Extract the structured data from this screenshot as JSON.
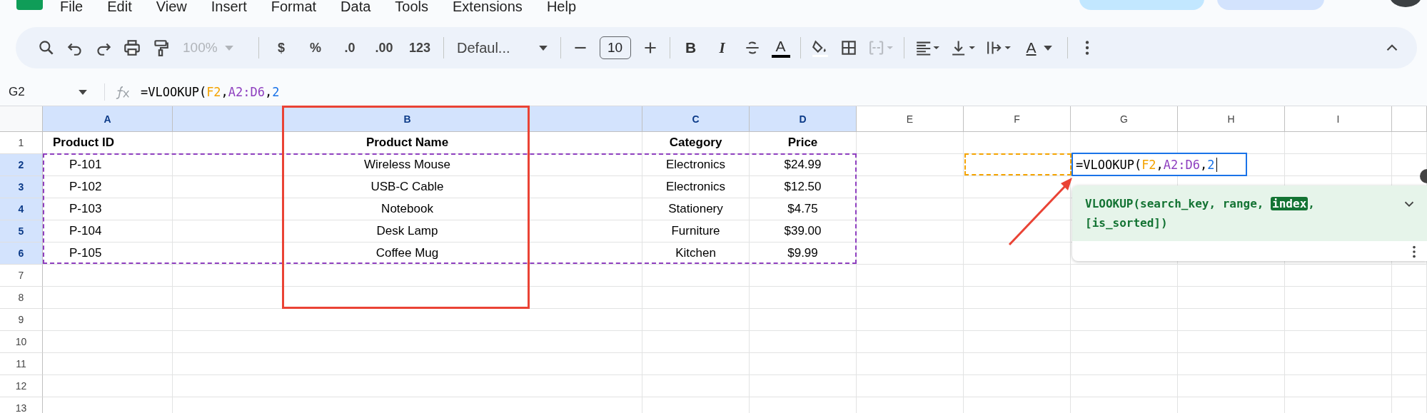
{
  "menu": [
    {
      "label": "File"
    },
    {
      "label": "Edit"
    },
    {
      "label": "View"
    },
    {
      "label": "Insert"
    },
    {
      "label": "Format"
    },
    {
      "label": "Data"
    },
    {
      "label": "Tools"
    },
    {
      "label": "Extensions"
    },
    {
      "label": "Help"
    }
  ],
  "toolbar": {
    "zoom": {
      "value": "100%",
      "disabled": true
    },
    "number_formats": [
      "$",
      "%",
      ".0",
      ".00",
      "123"
    ],
    "font": {
      "value": "Defaul..."
    },
    "font_size": {
      "value": "10"
    },
    "bold": "B",
    "italic": "I",
    "text_color": {
      "glyph": "A",
      "color": "#000000"
    },
    "merge": {
      "disabled": true
    },
    "rotate": "A"
  },
  "formula_bar": {
    "cell": "G2",
    "formula": [
      {
        "text": "=VLOOKUP(",
        "color": "#000000"
      },
      {
        "text": "F2",
        "color": "#f4a300"
      },
      {
        "text": ",",
        "color": "#000000"
      },
      {
        "text": "A2:D6",
        "color": "#8e3fbf"
      },
      {
        "text": ",",
        "color": "#000000"
      },
      {
        "text": "2",
        "color": "#1a73e8"
      }
    ]
  },
  "sheet": {
    "columns": [
      {
        "label": "A",
        "selected": true
      },
      {
        "label": "B",
        "selected": true
      },
      {
        "label": "C",
        "selected": true
      },
      {
        "label": "D",
        "selected": true
      },
      {
        "label": "E",
        "selected": false
      },
      {
        "label": "F",
        "selected": false
      },
      {
        "label": "G",
        "selected": false
      },
      {
        "label": "H",
        "selected": false
      },
      {
        "label": "I",
        "selected": false
      }
    ],
    "rows": [
      {
        "label": "1",
        "selected": false,
        "kind": "header",
        "cells": [
          "Product ID",
          "Product Name",
          "Category",
          "Price"
        ]
      },
      {
        "label": "2",
        "selected": true,
        "kind": "data",
        "cells": [
          "P-101",
          "Wireless Mouse",
          "Electronics",
          "$24.99"
        ]
      },
      {
        "label": "3",
        "selected": true,
        "kind": "data",
        "cells": [
          "P-102",
          "USB-C Cable",
          "Electronics",
          "$12.50"
        ]
      },
      {
        "label": "4",
        "selected": true,
        "kind": "data",
        "cells": [
          "P-103",
          "Notebook",
          "Stationery",
          "$4.75"
        ]
      },
      {
        "label": "5",
        "selected": true,
        "kind": "data",
        "cells": [
          "P-104",
          "Desk Lamp",
          "Furniture",
          "$39.00"
        ]
      },
      {
        "label": "6",
        "selected": true,
        "kind": "data",
        "cells": [
          "P-105",
          "Coffee Mug",
          "Kitchen",
          "$9.99"
        ]
      },
      {
        "label": "7",
        "selected": false
      },
      {
        "label": "8",
        "selected": false
      },
      {
        "label": "9",
        "selected": false
      },
      {
        "label": "10",
        "selected": false
      },
      {
        "label": "11",
        "selected": false
      },
      {
        "label": "12",
        "selected": false
      },
      {
        "label": "13",
        "selected": false
      }
    ],
    "editor": {
      "formula": [
        {
          "text": "=VLOOKUP(",
          "color": "#000000"
        },
        {
          "text": "F2",
          "color": "#f4a300"
        },
        {
          "text": ",",
          "color": "#000000"
        },
        {
          "text": "A2:D6",
          "color": "#8e3fbf"
        },
        {
          "text": ",",
          "color": "#000000"
        },
        {
          "text": "2",
          "color": "#1a73e8"
        }
      ]
    },
    "hint": {
      "lines": [
        [
          {
            "text": "VLOOKUP(search_key, range, ",
            "highlighted": false
          },
          {
            "text": "index",
            "highlighted": true
          },
          {
            "text": ",",
            "highlighted": false
          }
        ],
        [
          {
            "text": "[is_sorted])",
            "highlighted": false
          }
        ]
      ]
    }
  },
  "annotations": {
    "highlight_box": {
      "color": "#ea4335"
    },
    "arrow": {
      "color": "#ea4335"
    }
  }
}
